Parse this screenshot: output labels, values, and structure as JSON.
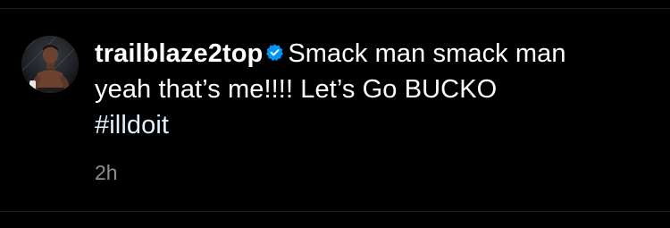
{
  "comment": {
    "username": "trailblaze2top",
    "verified": true,
    "text_line1": "Smack man smack man",
    "text_line2": "yeah that’s me!!!! Let’s Go BUCKO",
    "hashtag": "#illdoit",
    "timestamp": "2h"
  },
  "icons": {
    "verified": "verified-badge-icon",
    "avatar": "profile-photo"
  },
  "colors": {
    "background": "#000000",
    "text": "#ffffff",
    "hashtag": "#e0f1ff",
    "verified_badge": "#0095f6",
    "timestamp": "#8e8e93"
  }
}
